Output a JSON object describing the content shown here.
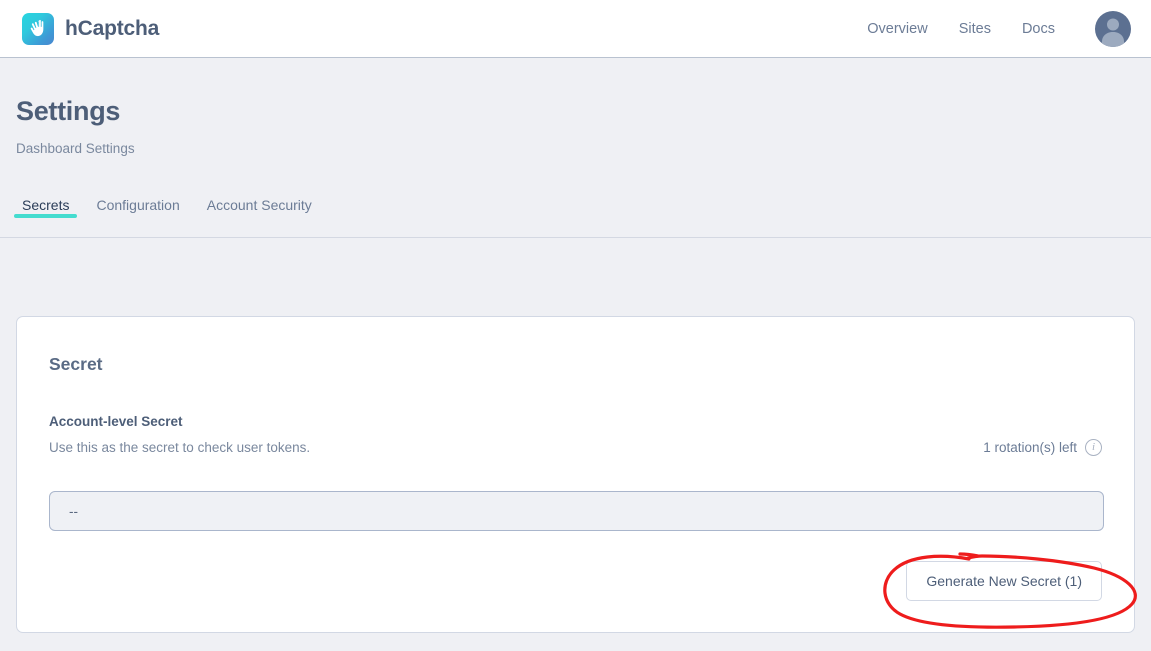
{
  "header": {
    "brand_name": "hCaptcha",
    "brand_logo_icon": "hcaptcha-hand-logo",
    "nav": [
      {
        "label": "Overview",
        "name": "nav-overview"
      },
      {
        "label": "Sites",
        "name": "nav-sites"
      },
      {
        "label": "Docs",
        "name": "nav-docs"
      }
    ],
    "avatar_icon": "user-avatar"
  },
  "page": {
    "title": "Settings",
    "subtitle": "Dashboard Settings"
  },
  "tabs": [
    {
      "label": "Secrets",
      "active": true
    },
    {
      "label": "Configuration",
      "active": false
    },
    {
      "label": "Account Security",
      "active": false
    }
  ],
  "card": {
    "title": "Secret",
    "field_label": "Account-level Secret",
    "field_help": "Use this as the secret to check user tokens.",
    "rotation_text": "1 rotation(s) left",
    "info_icon": "info-circle-icon",
    "info_glyph": "i",
    "secret_value": "--",
    "secret_placeholder": "--",
    "generate_button": "Generate New Secret (1)"
  },
  "annotation": {
    "shape": "hand-drawn-ellipse",
    "color": "#ee1c1c",
    "target": "generate-new-secret-button"
  },
  "colors": {
    "page_background": "#eff0f4",
    "header_background": "#ffffff",
    "accent_teal": "#44dccf",
    "text_primary": "#4d5e78",
    "text_muted": "#7a889e",
    "annotation_red": "#ee1c1c"
  }
}
